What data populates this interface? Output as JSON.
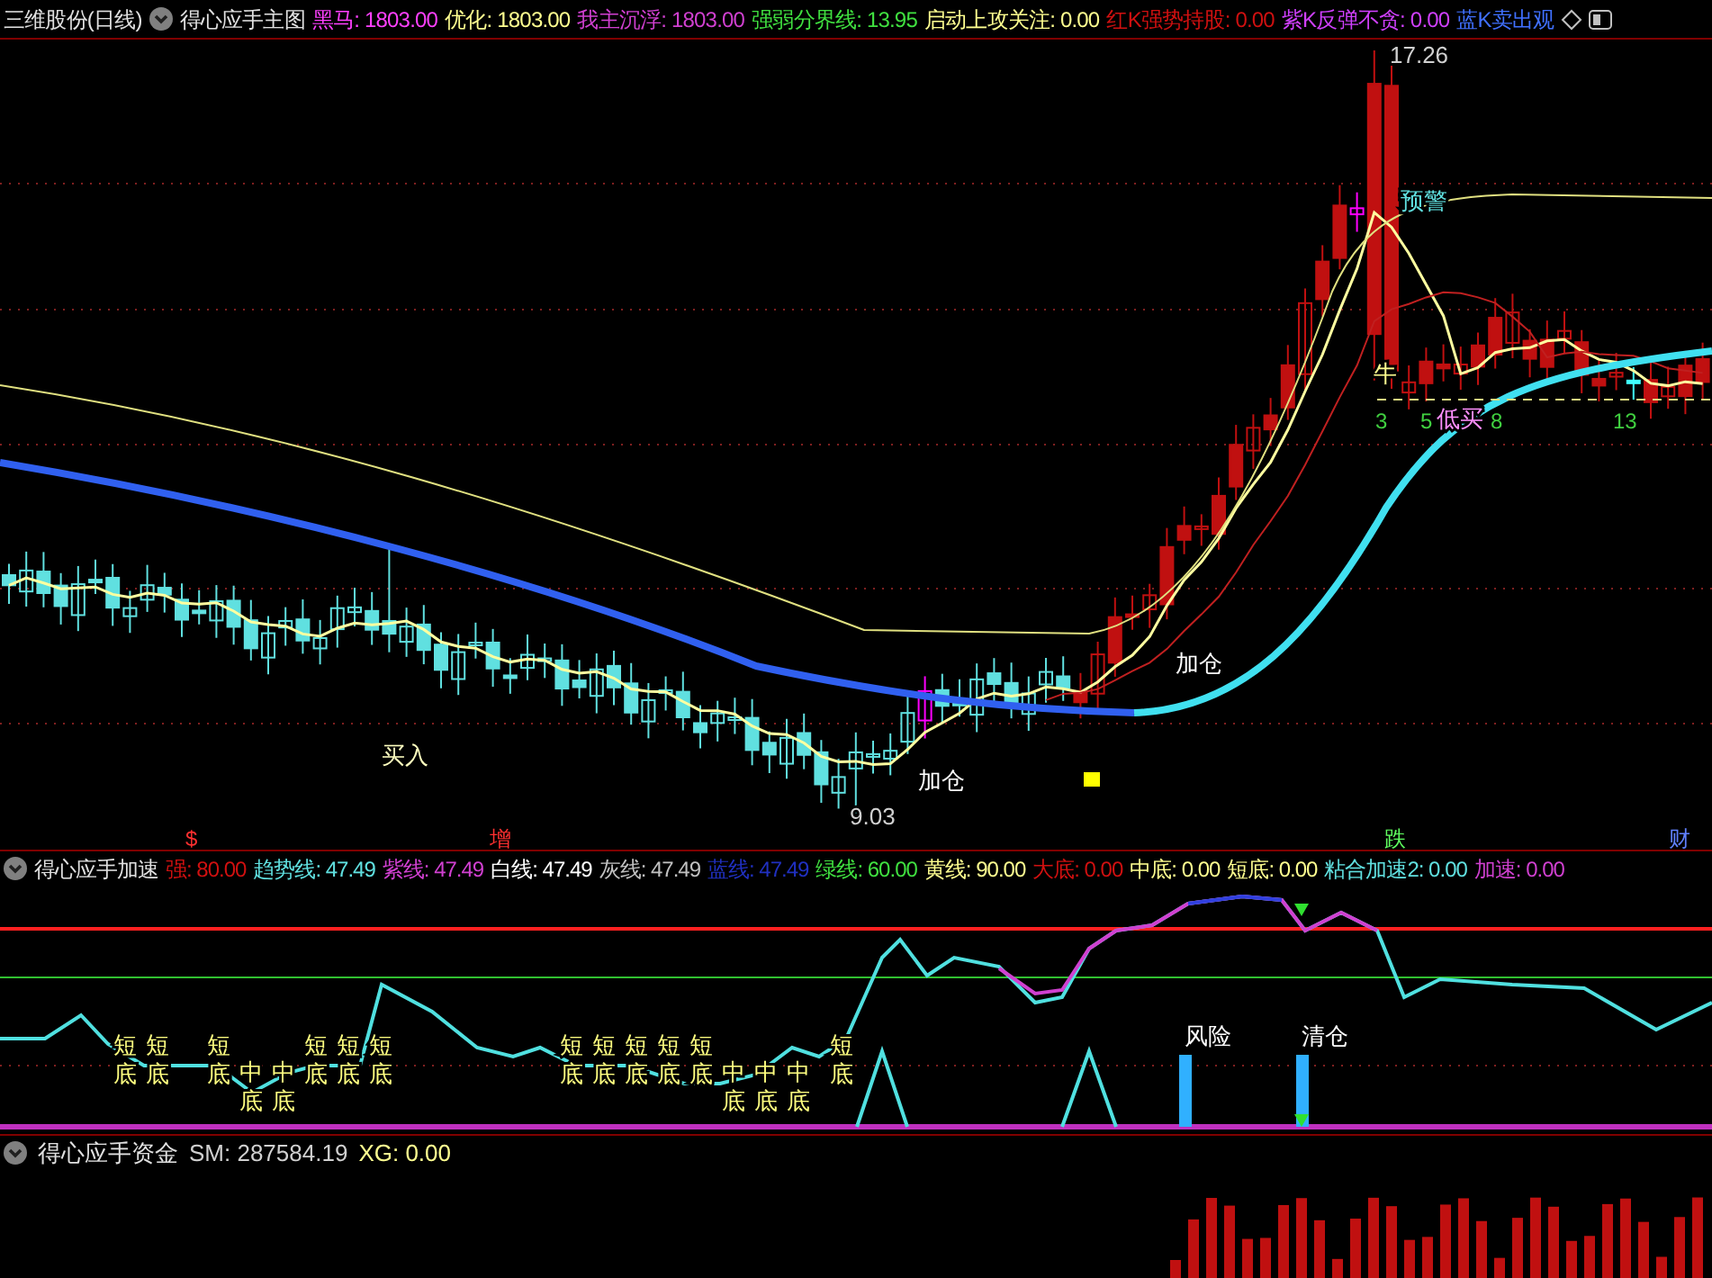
{
  "main_panel": {
    "stock": "三维股份(日线)",
    "indicator": "得心应手主图",
    "readouts": [
      {
        "text": "黑马: 1803.00",
        "color": "#ff40ff"
      },
      {
        "text": "优化: 1803.00",
        "color": "#ffff90"
      },
      {
        "text": "我主沉浮: 1803.00",
        "color": "#d040d0"
      },
      {
        "text": "强弱分界线: 13.95",
        "color": "#40e040"
      },
      {
        "text": "启动上攻关注: 0.00",
        "color": "#ffff90"
      },
      {
        "text": "红K强势持股: 0.00",
        "color": "#d01010"
      },
      {
        "text": "紫K反弹不贪: 0.00",
        "color": "#d040ff"
      },
      {
        "text": "蓝K卖出观",
        "color": "#4070ff"
      }
    ],
    "high_price": "17.26",
    "low_price": "9.03",
    "labels": [
      {
        "text": "预警",
        "color": "#60e0e0"
      },
      {
        "text": "牛",
        "color": "#ffff90"
      },
      {
        "text": "低买",
        "color": "#ff90ff"
      },
      {
        "text": "加仓",
        "color": "#ffffff"
      },
      {
        "text": "加仓",
        "color": "#ffffff"
      },
      {
        "text": "买入",
        "color": "#ffffc0"
      }
    ],
    "counts": [
      "3",
      "5",
      "8",
      "13"
    ],
    "signals": [
      {
        "text": "$",
        "color": "#ff3030"
      },
      {
        "text": "增",
        "color": "#ff3030"
      },
      {
        "text": "跌",
        "color": "#60ff60"
      },
      {
        "text": "财",
        "color": "#6080ff"
      }
    ]
  },
  "acceleration_panel": {
    "indicator": "得心应手加速",
    "readouts": [
      {
        "text": "强: 80.00",
        "color": "#d01010"
      },
      {
        "text": "趋势线: 47.49",
        "color": "#60e0e0"
      },
      {
        "text": "紫线: 47.49",
        "color": "#d040d0"
      },
      {
        "text": "白线: 47.49",
        "color": "#ffffff"
      },
      {
        "text": "灰线: 47.49",
        "color": "#c0c0c0"
      },
      {
        "text": "蓝线: 47.49",
        "color": "#2030c0"
      },
      {
        "text": "绿线: 60.00",
        "color": "#40e040"
      },
      {
        "text": "黄线: 90.00",
        "color": "#ffff90"
      },
      {
        "text": "大底: 0.00",
        "color": "#d01010"
      },
      {
        "text": "中底: 0.00",
        "color": "#ffff90"
      },
      {
        "text": "短底: 0.00",
        "color": "#ffff90"
      },
      {
        "text": "粘合加速2: 0.00",
        "color": "#60e0e0"
      },
      {
        "text": "加速: 0.00",
        "color": "#d040d0"
      }
    ],
    "bottom_marks": [
      {
        "kind": "short",
        "upper": "短",
        "lower": "底"
      },
      {
        "kind": "short",
        "upper": "短",
        "lower": "底"
      },
      {
        "kind": "short",
        "upper": "短",
        "lower": "底"
      },
      {
        "kind": "mid",
        "upper": "中",
        "lower": "底"
      },
      {
        "kind": "mid",
        "upper": "中",
        "lower": "底"
      },
      {
        "kind": "short",
        "upper": "短",
        "lower": "底"
      },
      {
        "kind": "short",
        "upper": "短",
        "lower": "底"
      },
      {
        "kind": "short",
        "upper": "短",
        "lower": "底"
      },
      {
        "kind": "short",
        "upper": "短",
        "lower": "底"
      },
      {
        "kind": "short",
        "upper": "短",
        "lower": "底"
      },
      {
        "kind": "short",
        "upper": "短",
        "lower": "底"
      },
      {
        "kind": "short",
        "upper": "短",
        "lower": "底"
      },
      {
        "kind": "short",
        "upper": "短",
        "lower": "底"
      },
      {
        "kind": "mid",
        "upper": "中",
        "lower": "底"
      },
      {
        "kind": "mid",
        "upper": "中",
        "lower": "底"
      },
      {
        "kind": "mid",
        "upper": "中",
        "lower": "底"
      },
      {
        "kind": "short",
        "upper": "短",
        "lower": "底"
      }
    ],
    "alerts": [
      "风险",
      "清仓"
    ]
  },
  "fund_panel": {
    "indicator": "得心应手资金",
    "readouts": [
      {
        "text": "SM: 287584.19",
        "color": "#d0d0d0"
      },
      {
        "text": "XG: 0.00",
        "color": "#ffff90"
      }
    ]
  }
}
